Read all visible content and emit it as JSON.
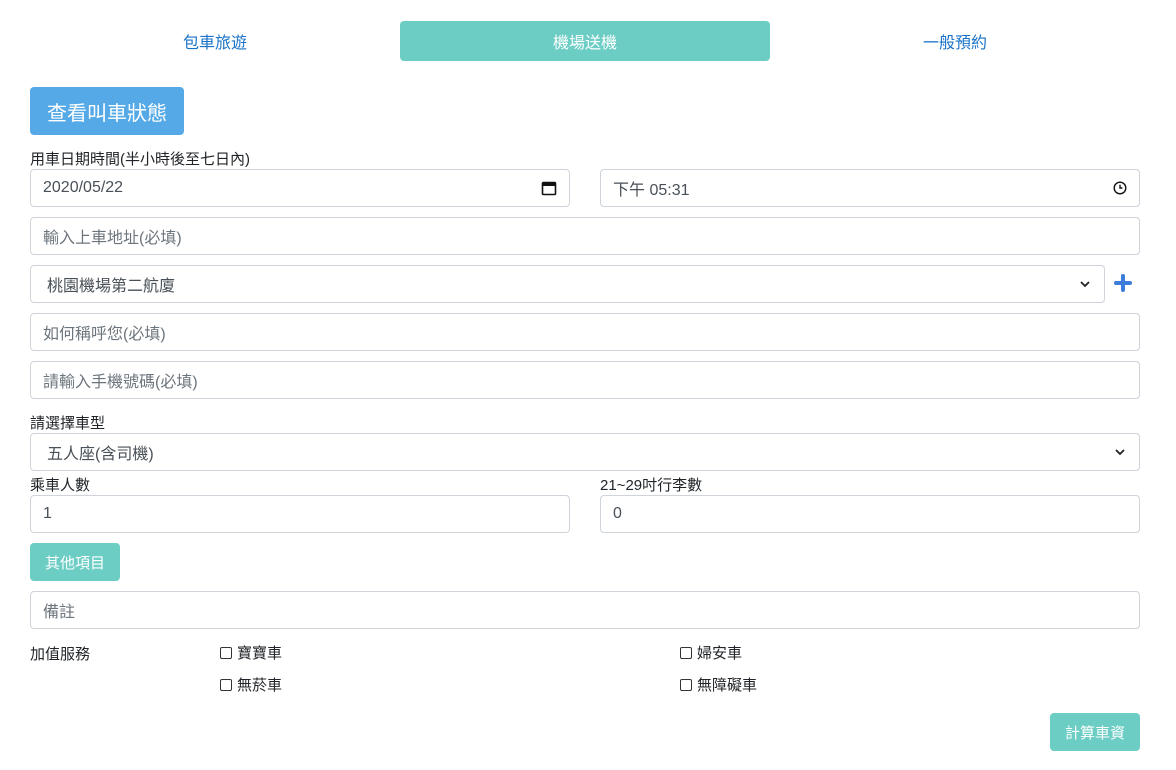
{
  "tabs": [
    {
      "label": "包車旅遊"
    },
    {
      "label": "機場送機"
    },
    {
      "label": "一般預約"
    }
  ],
  "status_button": "查看叫車狀態",
  "datetime": {
    "label": "用車日期時間(半小時後至七日內)",
    "date_value": "2020/05/22",
    "time_value": "下午 05:31"
  },
  "pickup_address": {
    "placeholder": "輸入上車地址(必填)"
  },
  "airport_select": {
    "value": "桃園機場第二航廈"
  },
  "name_field": {
    "placeholder": "如何稱呼您(必填)"
  },
  "phone_field": {
    "placeholder": "請輸入手機號碼(必填)"
  },
  "car_type": {
    "label": "請選擇車型",
    "value": "五人座(含司機)"
  },
  "passengers": {
    "label": "乘車人數",
    "value": "1"
  },
  "luggage": {
    "label": "21~29吋行李數",
    "value": "0"
  },
  "other_items_button": "其他項目",
  "notes_field": {
    "placeholder": "備註"
  },
  "services": {
    "label": "加值服務",
    "options": [
      "寶寶車",
      "婦安車",
      "無菸車",
      "無障礙車"
    ]
  },
  "calculate_button": "計算車資",
  "colors": {
    "accent_teal": "#6ccdc4",
    "accent_blue": "#55a9e6",
    "link_blue": "#1a73c8",
    "plus_blue": "#3b7ddd"
  }
}
